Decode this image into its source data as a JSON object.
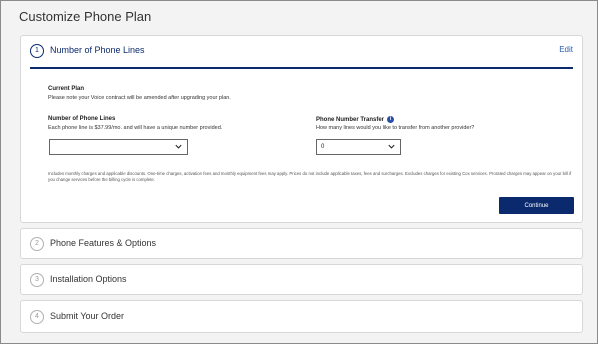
{
  "page": {
    "title": "Customize Phone Plan"
  },
  "steps": [
    {
      "number": "1",
      "title": "Number of Phone Lines",
      "edit": "Edit"
    },
    {
      "number": "2",
      "title": "Phone Features & Options"
    },
    {
      "number": "3",
      "title": "Installation Options"
    },
    {
      "number": "4",
      "title": "Submit Your Order"
    }
  ],
  "current_plan": {
    "heading": "Current Plan",
    "note": "Please note your Voice contract will be amended after upgrading your plan."
  },
  "phone_lines": {
    "label": "Number of Phone Lines",
    "help": "Each phone line is $37.99/mo. and will have a unique number provided.",
    "value": ""
  },
  "transfer": {
    "label": "Phone Number Transfer",
    "info_icon_text": "i",
    "help": "How many lines would you like to transfer from another provider?",
    "value": "0"
  },
  "disclaimer": "Includes monthly charges and applicable discounts. One-time charges, activation fees and monthly equipment fees may apply. Prices do not include applicable taxes, fees and surcharges. Excludes charges for existing Cox services. Prorated charges may appear on your bill if you change services before the billing cycle is complete.",
  "continue_label": "Continue",
  "colors": {
    "accent": "#0b2a6e",
    "link": "#2a5db0"
  }
}
